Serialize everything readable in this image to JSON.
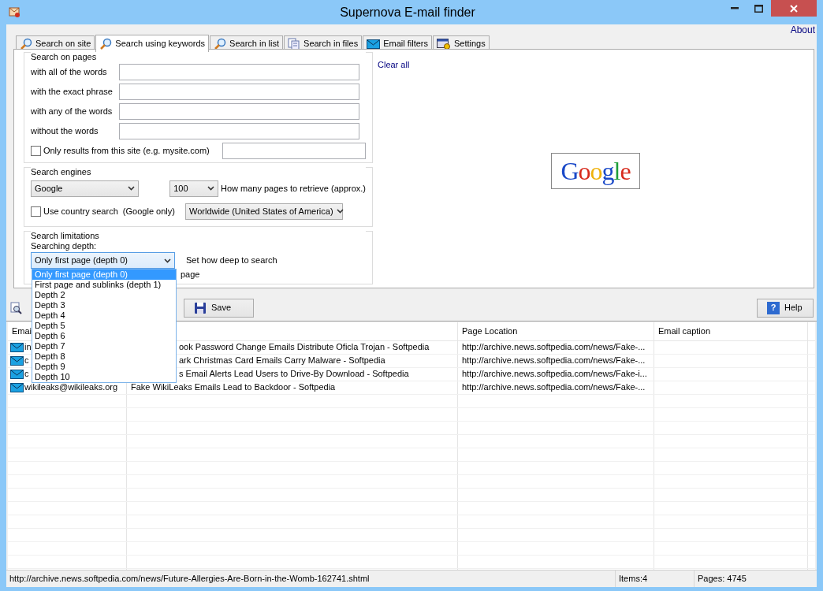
{
  "window": {
    "title": "Supernova E-mail finder"
  },
  "about_link": "About",
  "tabs": [
    {
      "label": "Search on site",
      "selected": false
    },
    {
      "label": "Search using keywords",
      "selected": true
    },
    {
      "label": "Search in list",
      "selected": false
    },
    {
      "label": "Search in files",
      "selected": false
    },
    {
      "label": "Email filters",
      "selected": false
    },
    {
      "label": "Settings",
      "selected": false
    }
  ],
  "search_on_pages": {
    "title": "Search on pages",
    "fields": [
      {
        "label": "with all of the words"
      },
      {
        "label": "with the exact phrase"
      },
      {
        "label": "with any of the words"
      },
      {
        "label": "without the words"
      }
    ],
    "site_only": {
      "label": "Only results from this site (e.g. mysite.com)",
      "checked": false
    }
  },
  "search_engines": {
    "title": "Search engines",
    "engine": "Google",
    "pages": "100",
    "pages_label": "How many pages to retrieve (approx.)",
    "country_search": {
      "label": "Use country search  (Google only)",
      "checked": false
    },
    "country": "Worldwide (United States of America)"
  },
  "search_limitations": {
    "title": "Search limitations",
    "depth_label": "Searching depth:",
    "depth_value": "Only first page (depth 0)",
    "depth_hint": "Set how deep to search",
    "partial_text": "page",
    "depth_options": [
      {
        "label": "Only first page (depth 0)",
        "selected": true
      },
      {
        "label": "First page and sublinks (depth 1)",
        "selected": false
      },
      {
        "label": "Depth 2",
        "selected": false
      },
      {
        "label": "Depth 3",
        "selected": false
      },
      {
        "label": "Depth 4",
        "selected": false
      },
      {
        "label": "Depth 5",
        "selected": false
      },
      {
        "label": "Depth 6",
        "selected": false
      },
      {
        "label": "Depth 7",
        "selected": false
      },
      {
        "label": "Depth 8",
        "selected": false
      },
      {
        "label": "Depth 9",
        "selected": false
      },
      {
        "label": "Depth 10",
        "selected": false
      }
    ]
  },
  "clear_all_link": "Clear all",
  "engine_logo": "Google",
  "toolbar": {
    "save_button": "Save",
    "help_icon": "?",
    "help_button": "Help"
  },
  "table": {
    "columns": [
      "Emai",
      "",
      "Page Location",
      "Email caption"
    ],
    "rows": [
      {
        "email": "in",
        "title": "ook Password Change Emails Distribute Oficla Trojan - Softpedia",
        "location": "http://archive.news.softpedia.com/news/Fake-...",
        "partly_hidden": true
      },
      {
        "email": "c",
        "title": "ark Christmas Card Emails Carry Malware - Softpedia",
        "location": "http://archive.news.softpedia.com/news/Fake-...",
        "partly_hidden": true
      },
      {
        "email": "c",
        "title": "s Email Alerts Lead Users to Drive-By Download - Softpedia",
        "location": "http://archive.news.softpedia.com/news/Fake-i...",
        "partly_hidden": true
      },
      {
        "email": "wikileaks@wikileaks.org",
        "title": "Fake WikiLeaks Emails Lead to Backdoor - Softpedia",
        "location": "http://archive.news.softpedia.com/news/Fake-...",
        "partly_hidden": false
      }
    ]
  },
  "status_bar": {
    "url": "http://archive.news.softpedia.com/news/Future-Allergies-Are-Born-in-the-Womb-162741.shtml",
    "items": "Items:4",
    "pages": "Pages: 4745"
  }
}
